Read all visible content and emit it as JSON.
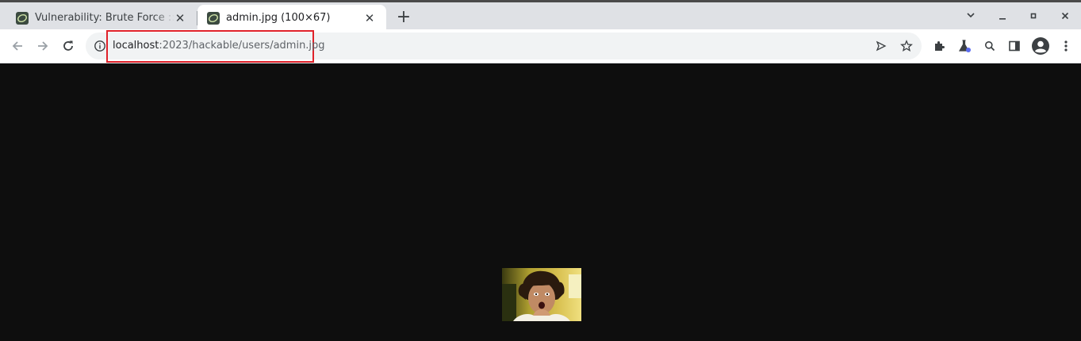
{
  "tabs": [
    {
      "title": "Vulnerability: Brute Force :: Damn Vulnerable Web Application (DVWA)",
      "favicon": "dvwa-icon",
      "active": false
    },
    {
      "title": "admin.jpg (100×67)",
      "favicon": "dvwa-icon",
      "active": true
    }
  ],
  "address_bar": {
    "host": "localhost",
    "path": ":2023/hackable/users/admin.jpg",
    "highlight_color": "#e0222a"
  },
  "icons": {
    "back": "arrow-left-icon",
    "forward": "arrow-right-icon",
    "reload": "reload-icon",
    "site_info": "info-icon",
    "send": "send-icon",
    "bookmark": "star-icon",
    "extensions": "puzzle-icon",
    "labs": "flask-icon",
    "search": "search-icon",
    "side_panel": "side-panel-icon",
    "profile": "profile-icon",
    "menu": "kebab-menu-icon"
  },
  "image": {
    "description": "admin.jpg",
    "background": "#0e0e0e"
  }
}
